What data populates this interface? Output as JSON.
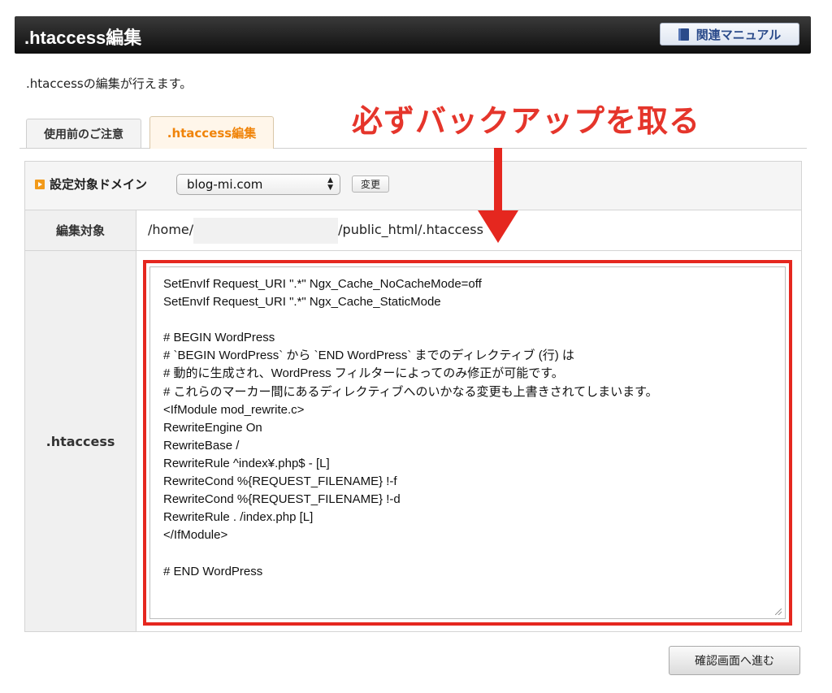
{
  "header": {
    "title": ".htaccess編集",
    "manual_button": "関連マニュアル"
  },
  "intro_text": ".htaccessの編集が行えます。",
  "annotation": {
    "callout": "必ずバックアップを取る"
  },
  "tabs": [
    {
      "label": "使用前のご注意",
      "active": false
    },
    {
      "label": ".htaccess編集",
      "active": true
    }
  ],
  "domain": {
    "label": "設定対象ドメイン",
    "selected": "blog-mi.com",
    "change_button": "変更"
  },
  "target": {
    "label": "編集対象",
    "path_prefix": "/home/",
    "path_suffix": "/public_html/.htaccess"
  },
  "htaccess": {
    "label": ".htaccess",
    "content": "SetEnvIf Request_URI \".*\" Ngx_Cache_NoCacheMode=off\nSetEnvIf Request_URI \".*\" Ngx_Cache_StaticMode\n\n# BEGIN WordPress\n# `BEGIN WordPress` から `END WordPress` までのディレクティブ (行) は\n# 動的に生成され、WordPress フィルターによってのみ修正が可能です。\n# これらのマーカー間にあるディレクティブへのいかなる変更も上書きされてしまいます。\n<IfModule mod_rewrite.c>\nRewriteEngine On\nRewriteBase /\nRewriteRule ^index¥.php$ - [L]\nRewriteCond %{REQUEST_FILENAME} !-f\nRewriteCond %{REQUEST_FILENAME} !-d\nRewriteRule . /index.php [L]\n</IfModule>\n\n# END WordPress"
  },
  "confirm_button": "確認画面へ進む",
  "colors": {
    "accent_red": "#e5271f",
    "active_tab": "#f0840a",
    "header_bg": "#111111"
  }
}
